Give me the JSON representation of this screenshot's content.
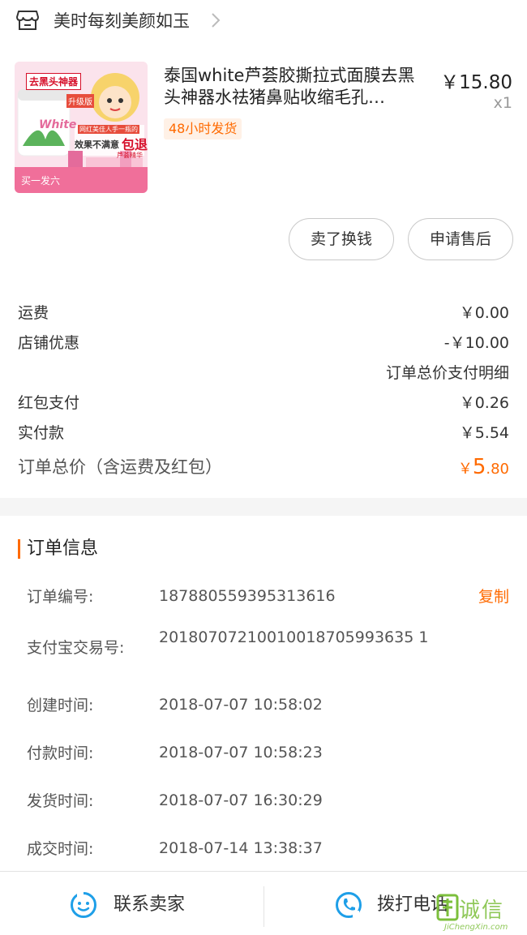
{
  "shop": {
    "name": "美时每刻美颜如玉"
  },
  "product": {
    "title": "泰国white芦荟胶撕拉式面膜去黑头神器水祛猪鼻贴收缩毛孔…",
    "price": "￥15.80",
    "qty": "x1",
    "tag": "48小时发货",
    "thumb_text": {
      "badge": "去黑头神器",
      "upgrade": "升级版",
      "brand": "White",
      "promo1": "网红美佳人手一瓶的",
      "promo2": "效果不满意",
      "promo3": "包退",
      "sub": "芦荟精华",
      "bottom": "买一发六"
    }
  },
  "actions": {
    "sell": "卖了换钱",
    "after_sale": "申请售后"
  },
  "fees": {
    "shipping_label": "运费",
    "shipping_value": "￥0.00",
    "discount_label": "店铺优惠",
    "discount_value": "-￥10.00",
    "detail_link": "订单总价支付明细",
    "redpacket_label": "红包支付",
    "redpacket_value": "￥0.26",
    "paid_label": "实付款",
    "paid_value": "￥5.54",
    "total_label": "订单总价（含运费及红包）",
    "total_yen": "￥",
    "total_int": "5",
    "total_dec": ".80"
  },
  "order_info": {
    "title": "订单信息",
    "copy": "复制",
    "rows": [
      {
        "label": "订单编号:",
        "value": "187880559395313616"
      },
      {
        "label": "支付宝交易号:",
        "value": "20180707210010018705993635 1"
      },
      {
        "label": "创建时间:",
        "value": "2018-07-07 10:58:02"
      },
      {
        "label": "付款时间:",
        "value": "2018-07-07 10:58:23"
      },
      {
        "label": "发货时间:",
        "value": "2018-07-07 16:30:29"
      },
      {
        "label": "成交时间:",
        "value": "2018-07-14 13:38:37"
      }
    ]
  },
  "bottom": {
    "contact": "联系卖家",
    "call": "拨打电话"
  },
  "watermark": {
    "text": "诚信",
    "sub": "JiChengXin.com"
  },
  "colors": {
    "accent": "#ff6a00",
    "icon_blue": "#1e9fe8",
    "watermark": "#7cbf3c"
  }
}
